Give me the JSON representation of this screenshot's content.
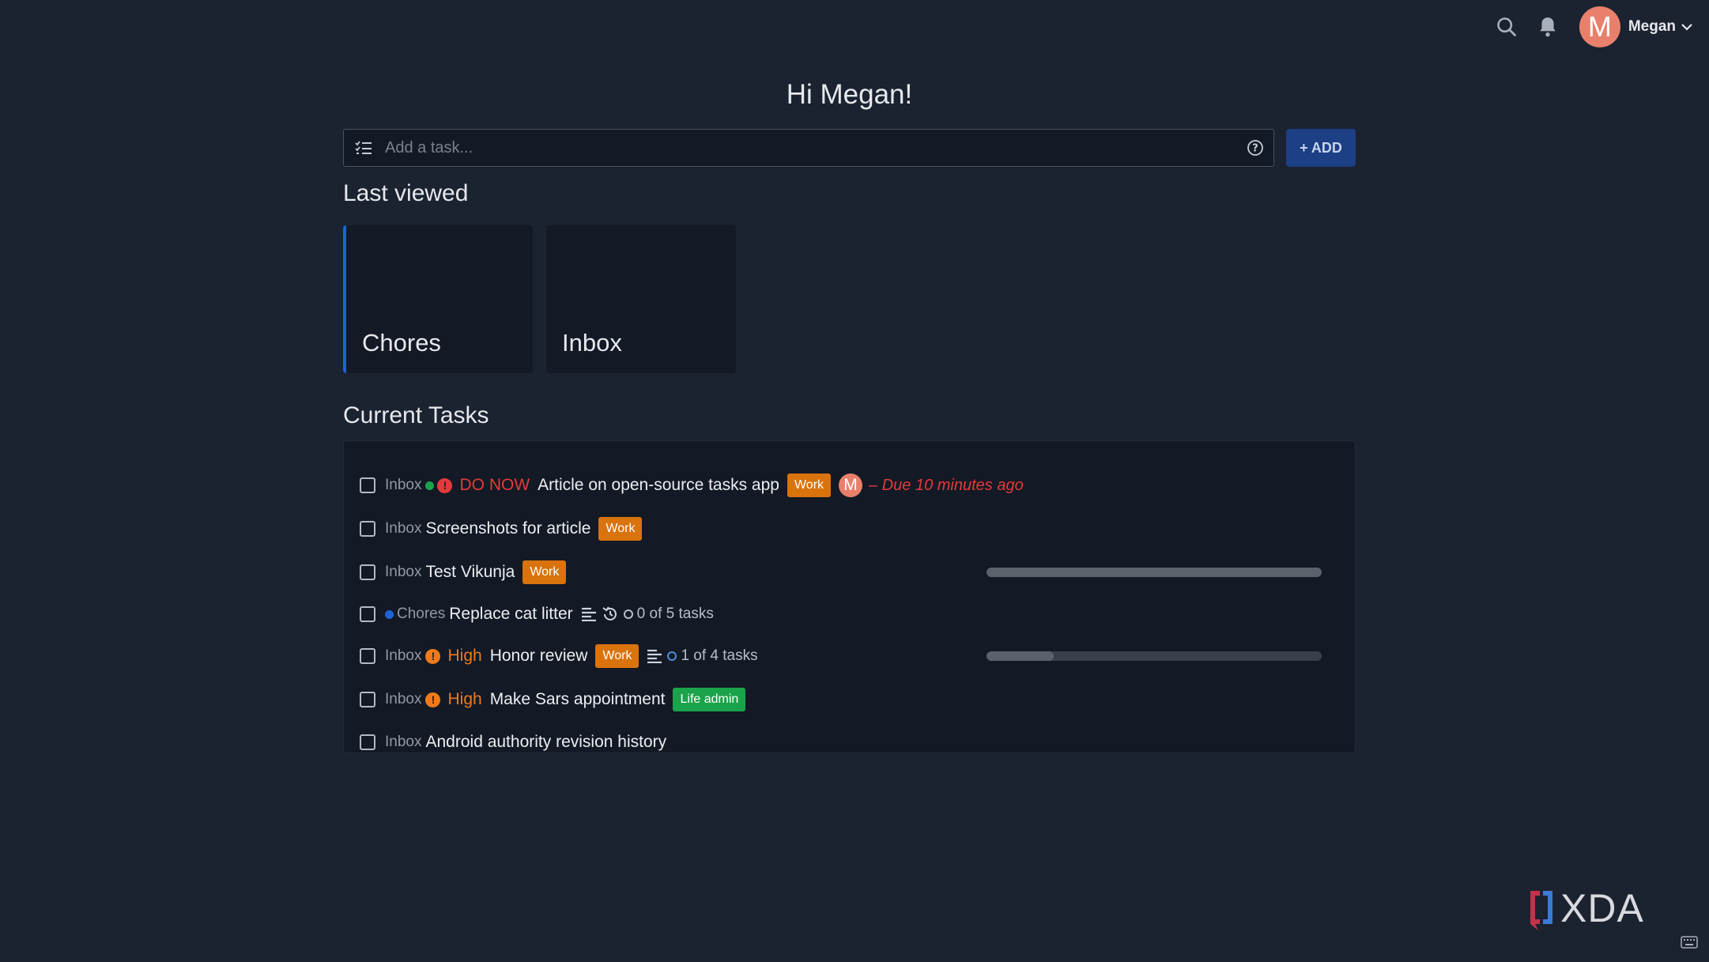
{
  "user": {
    "name": "Megan",
    "avatar_initial": "M"
  },
  "icons": {
    "search": "search-icon",
    "notifications": "bell-icon",
    "menu": "chevron-down-icon"
  },
  "greeting": "Hi Megan!",
  "add_task": {
    "placeholder": "Add a task...",
    "button_label": "+ ADD"
  },
  "last_viewed": {
    "title": "Last viewed",
    "cards": [
      {
        "title": "Chores"
      },
      {
        "title": "Inbox"
      }
    ]
  },
  "current_tasks": {
    "title": "Current Tasks",
    "tasks": [
      {
        "project": "Inbox",
        "priority": "DO NOW",
        "title": "Article on open-source tasks app",
        "label": "Work",
        "assignee": "M",
        "due": "– Due 10 minutes ago",
        "done": false
      },
      {
        "project": "Inbox",
        "title": "Screenshots for article",
        "label": "Work",
        "done": false
      },
      {
        "project": "Inbox",
        "title": "Test Vikunja",
        "label": "Work",
        "progress": 1.0,
        "done": false
      },
      {
        "project": "Chores",
        "title": "Replace cat litter",
        "subtasks": "0 of 5 tasks",
        "done": false
      },
      {
        "project": "Inbox",
        "priority": "High",
        "title": "Honor review",
        "label": "Work",
        "subtasks": "1 of 4 tasks",
        "progress": 0.2,
        "done": false
      },
      {
        "project": "Inbox",
        "priority": "High",
        "title": "Make Sars appointment",
        "label": "Life admin",
        "done": false
      },
      {
        "project": "Inbox",
        "title": "Android authority revision history",
        "done": false
      }
    ]
  },
  "colors": {
    "background": "#1b2230",
    "panel": "#131925",
    "accent": "#1d63d8",
    "label_work": "#d9730d",
    "label_life_admin": "#1aa34a",
    "priority_do_now": "#e33b3b",
    "priority_high": "#f07a1a",
    "due": "#e33b3b"
  },
  "watermark": "XDA"
}
